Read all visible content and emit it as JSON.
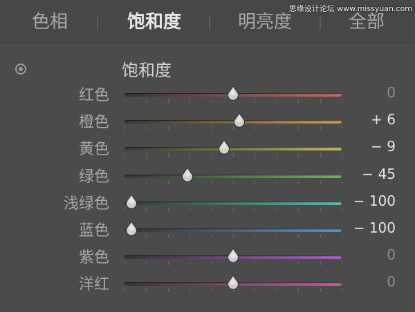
{
  "tabs": [
    {
      "label": "色相",
      "active": false
    },
    {
      "label": "饱和度",
      "active": true
    },
    {
      "label": "明亮度",
      "active": false
    },
    {
      "label": "全部",
      "active": false
    }
  ],
  "watermark": "思缘设计论坛 www.missyuan.com",
  "section": {
    "title": "饱和度"
  },
  "sliders": [
    {
      "label": "红色",
      "value": 0,
      "display": "0",
      "color_left": "#3a3333",
      "color_right": "#c26a6a"
    },
    {
      "label": "橙色",
      "value": 6,
      "display": "+ 6",
      "color_left": "#3a3633",
      "color_right": "#c79a5a"
    },
    {
      "label": "黄色",
      "value": -9,
      "display": "− 9",
      "color_left": "#393833",
      "color_right": "#c2b75e"
    },
    {
      "label": "绿色",
      "value": -45,
      "display": "− 45",
      "color_left": "#333833",
      "color_right": "#6fb25c"
    },
    {
      "label": "浅绿色",
      "value": -100,
      "display": "− 100",
      "color_left": "#333836",
      "color_right": "#5eb8a8"
    },
    {
      "label": "蓝色",
      "value": -100,
      "display": "− 100",
      "color_left": "#333538",
      "color_right": "#5b8fc2"
    },
    {
      "label": "紫色",
      "value": 0,
      "display": "0",
      "color_left": "#363338",
      "color_right": "#a661bf"
    },
    {
      "label": "洋红",
      "value": 0,
      "display": "0",
      "color_left": "#383336",
      "color_right": "#c25f9a"
    }
  ],
  "range": {
    "min": -100,
    "max": 100
  }
}
